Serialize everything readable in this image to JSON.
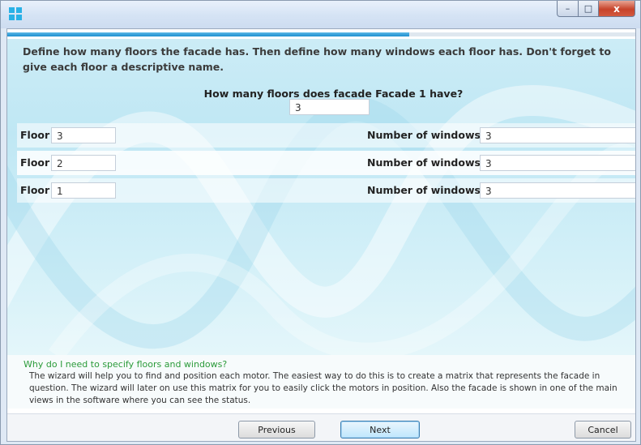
{
  "window": {
    "controls": {
      "minimize_glyph": "–",
      "maximize_glyph": "□",
      "close_glyph": "x"
    }
  },
  "progress": {
    "fraction": 0.64,
    "color": "#1d8fcf"
  },
  "instructions": "Define how many floors the facade has. Then define how many windows each floor has. Don't forget to give each floor a descriptive name.",
  "floors_question": {
    "label": "How many floors does facade Facade 1 have?",
    "value": "3"
  },
  "floor_rows": [
    {
      "floor_label": "Floor",
      "floor_value": "3",
      "windows_label": "Number of windows",
      "windows_value": "3"
    },
    {
      "floor_label": "Floor",
      "floor_value": "2",
      "windows_label": "Number of windows",
      "windows_value": "3"
    },
    {
      "floor_label": "Floor",
      "floor_value": "1",
      "windows_label": "Number of windows",
      "windows_value": "3"
    }
  ],
  "help": {
    "title": "Why do I need to specify floors and windows?",
    "body": "The wizard will help you to find and position each motor. The easiest way to do this is to create a matrix that represents the facade in question. The wizard will later on use this matrix for you to easily click the motors in position. Also the facade is shown in one of the main views in the software where you can see the status."
  },
  "buttons": {
    "previous": "Previous",
    "next": "Next",
    "cancel": "Cancel"
  },
  "colors": {
    "accent": "#29b1e6",
    "help_title": "#2b9b3a"
  }
}
